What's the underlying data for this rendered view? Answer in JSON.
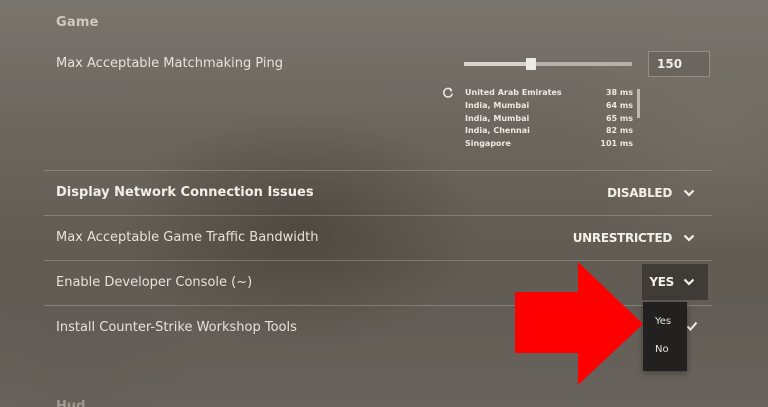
{
  "section": {
    "title": "Game",
    "next_title": "Hud"
  },
  "matchmaking_ping": {
    "label": "Max Acceptable Matchmaking Ping",
    "value": "150",
    "slider_fraction": 0.4,
    "regions": [
      {
        "name": "United Arab Emirates",
        "ping": "38 ms"
      },
      {
        "name": "India, Mumbai",
        "ping": "64 ms"
      },
      {
        "name": "India, Mumbai",
        "ping": "65 ms"
      },
      {
        "name": "India, Chennai",
        "ping": "82 ms"
      },
      {
        "name": "Singapore",
        "ping": "101 ms"
      }
    ]
  },
  "settings": {
    "network_issues": {
      "label": "Display Network Connection Issues",
      "value": "DISABLED"
    },
    "bandwidth": {
      "label": "Max Acceptable Game Traffic Bandwidth",
      "value": "UNRESTRICTED"
    },
    "dev_console": {
      "label": "Enable Developer Console (~)",
      "value": "YES",
      "options": [
        "Yes",
        "No"
      ]
    },
    "workshop_tools": {
      "label": "Install Counter-Strike Workshop Tools"
    }
  },
  "icons": {
    "refresh": "refresh-icon",
    "chevron": "chevron-down-icon",
    "check": "check-icon",
    "arrow": "red-arrow-annotation"
  },
  "colors": {
    "arrow": "#ff0000"
  }
}
